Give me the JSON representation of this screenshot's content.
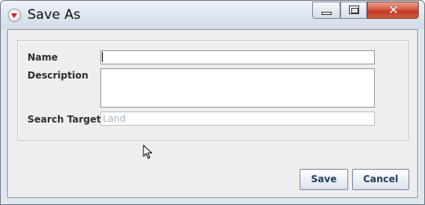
{
  "window": {
    "title": "Save As",
    "app_icon": "app-logo-icon",
    "controls": {
      "minimize_icon": "minimize-icon",
      "maximize_icon": "maximize-icon",
      "close_icon": "close-icon",
      "close_glyph": "✕"
    }
  },
  "form": {
    "name_label": "Name",
    "name_value": "",
    "description_label": "Description",
    "description_value": "",
    "search_target_label": "Search Target",
    "search_target_value": "Land"
  },
  "buttons": {
    "save_label": "Save",
    "cancel_label": "Cancel"
  },
  "colors": {
    "close_button": "#c13a22",
    "button_text": "#253d5c",
    "disabled_text": "#a6b6c6"
  }
}
